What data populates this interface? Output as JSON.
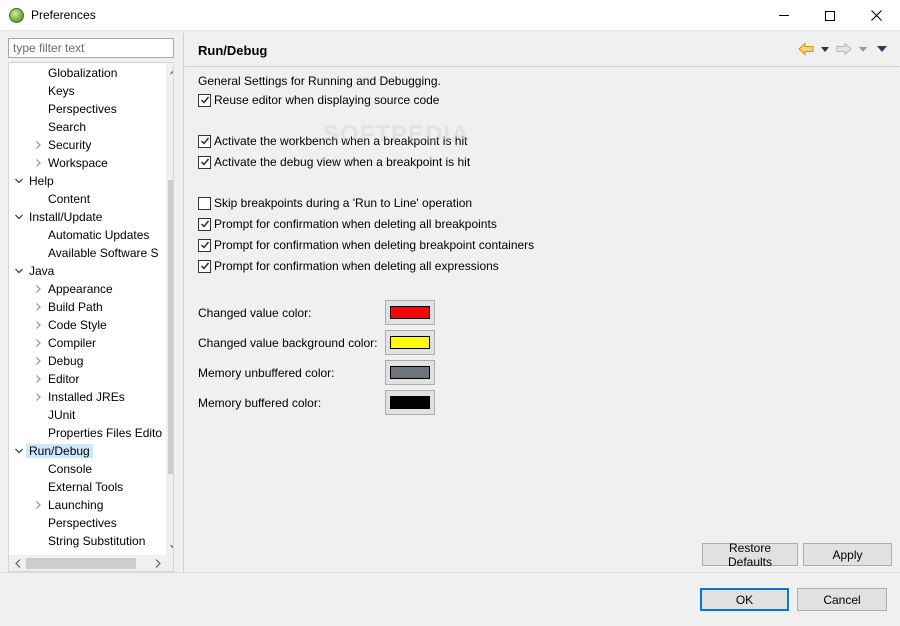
{
  "window": {
    "title": "Preferences",
    "watermark": "SOFTPEDIA"
  },
  "filter": {
    "placeholder": "type filter text",
    "value": ""
  },
  "tree": {
    "items": [
      {
        "label": "Globalization",
        "level": 2,
        "toggle": "none"
      },
      {
        "label": "Keys",
        "level": 2,
        "toggle": "none"
      },
      {
        "label": "Perspectives",
        "level": 2,
        "toggle": "none"
      },
      {
        "label": "Search",
        "level": 2,
        "toggle": "none"
      },
      {
        "label": "Security",
        "level": 2,
        "toggle": "collapsed"
      },
      {
        "label": "Workspace",
        "level": 2,
        "toggle": "collapsed"
      },
      {
        "label": "Help",
        "level": 1,
        "toggle": "expanded"
      },
      {
        "label": "Content",
        "level": 2,
        "toggle": "none"
      },
      {
        "label": "Install/Update",
        "level": 1,
        "toggle": "expanded"
      },
      {
        "label": "Automatic Updates",
        "level": 2,
        "toggle": "none"
      },
      {
        "label": "Available Software S",
        "level": 2,
        "toggle": "none"
      },
      {
        "label": "Java",
        "level": 1,
        "toggle": "expanded"
      },
      {
        "label": "Appearance",
        "level": 2,
        "toggle": "collapsed"
      },
      {
        "label": "Build Path",
        "level": 2,
        "toggle": "collapsed"
      },
      {
        "label": "Code Style",
        "level": 2,
        "toggle": "collapsed"
      },
      {
        "label": "Compiler",
        "level": 2,
        "toggle": "collapsed"
      },
      {
        "label": "Debug",
        "level": 2,
        "toggle": "collapsed"
      },
      {
        "label": "Editor",
        "level": 2,
        "toggle": "collapsed"
      },
      {
        "label": "Installed JREs",
        "level": 2,
        "toggle": "collapsed"
      },
      {
        "label": "JUnit",
        "level": 2,
        "toggle": "none"
      },
      {
        "label": "Properties Files Edito",
        "level": 2,
        "toggle": "none"
      },
      {
        "label": "Run/Debug",
        "level": 1,
        "toggle": "expanded",
        "selected": true
      },
      {
        "label": "Console",
        "level": 2,
        "toggle": "none"
      },
      {
        "label": "External Tools",
        "level": 2,
        "toggle": "none"
      },
      {
        "label": "Launching",
        "level": 2,
        "toggle": "collapsed"
      },
      {
        "label": "Perspectives",
        "level": 2,
        "toggle": "none"
      },
      {
        "label": "String Substitution",
        "level": 2,
        "toggle": "none"
      }
    ]
  },
  "page": {
    "title": "Run/Debug",
    "description": "General Settings for Running and Debugging.",
    "checkboxes": [
      {
        "label": "Reuse editor when displaying source code",
        "checked": true
      },
      {
        "label": "Activate the workbench when a breakpoint is hit",
        "checked": true
      },
      {
        "label": "Activate the debug view when a breakpoint is hit",
        "checked": true
      },
      {
        "label": "Skip breakpoints during a 'Run to Line' operation",
        "checked": false
      },
      {
        "label": "Prompt for confirmation when deleting all breakpoints",
        "checked": true
      },
      {
        "label": "Prompt for confirmation when deleting breakpoint containers",
        "checked": true
      },
      {
        "label": "Prompt for confirmation when deleting all expressions",
        "checked": true
      }
    ],
    "colors": [
      {
        "label": "Changed value color:",
        "color": "#ff0000"
      },
      {
        "label": "Changed value background color:",
        "color": "#ffff00"
      },
      {
        "label": "Memory unbuffered color:",
        "color": "#6e747c"
      },
      {
        "label": "Memory buffered color:",
        "color": "#000000"
      }
    ],
    "restore_defaults_label": "Restore Defaults",
    "apply_label": "Apply"
  },
  "footer": {
    "ok_label": "OK",
    "cancel_label": "Cancel"
  },
  "theme": {
    "accent": "#0078d7",
    "selection": "#cce8ff",
    "nav_back_arrow": "#e8b43a"
  }
}
